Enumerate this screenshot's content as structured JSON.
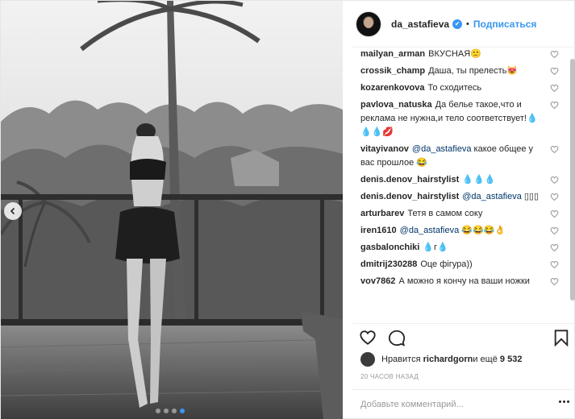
{
  "post": {
    "username": "da_astafieva",
    "verified_mark": "✔",
    "separator": "•",
    "follow_label": "Подписаться"
  },
  "comments": [
    {
      "author": "mailyan_arman",
      "text": "ВКУСНАЯ🙂"
    },
    {
      "author": "crossik_champ",
      "text": "Даша, ты прелесть😻"
    },
    {
      "author": "kozarenkovova",
      "text": "То сходитесь"
    },
    {
      "author": "pavlova_natuska",
      "text": "Да белье такое,что и реклама не нужна,и тело соответствует!💧💧💧💋"
    },
    {
      "author": "vitayivanov",
      "mention": "@da_astafieva",
      "text": " какое общее у вас прошлое 😂"
    },
    {
      "author": "denis.denov_hairstylist",
      "text": "💧💧💧"
    },
    {
      "author": "denis.denov_hairstylist",
      "mention": "@da_astafieva",
      "text": " ▯▯▯"
    },
    {
      "author": "arturbarev",
      "text": "Тетя в самом соку"
    },
    {
      "author": "iren1610",
      "mention": "@da_astafieva",
      "text": " 😂😂😂👌"
    },
    {
      "author": "gasbalonchiki",
      "text": "💧г💧"
    },
    {
      "author": "dmitrij230288",
      "text": "Оце фігура))"
    },
    {
      "author": "vov7862",
      "text": "А можно я кончу на ваши ножки"
    }
  ],
  "likes": {
    "prefix": "Нравится ",
    "user": "richardgorn",
    "middle": " и ещё ",
    "count": "9 532"
  },
  "timestamp": "20 ЧАСОВ НАЗАД",
  "comment_input": {
    "placeholder": "Добавьте комментарий..."
  },
  "icons": {
    "prev": "chevron-left-icon",
    "like": "heart-icon",
    "comment": "speech-bubble-icon",
    "save": "bookmark-icon",
    "more": "ellipsis-icon"
  },
  "colors": {
    "accent": "#3897f0",
    "text": "#262626",
    "muted": "#999999"
  }
}
